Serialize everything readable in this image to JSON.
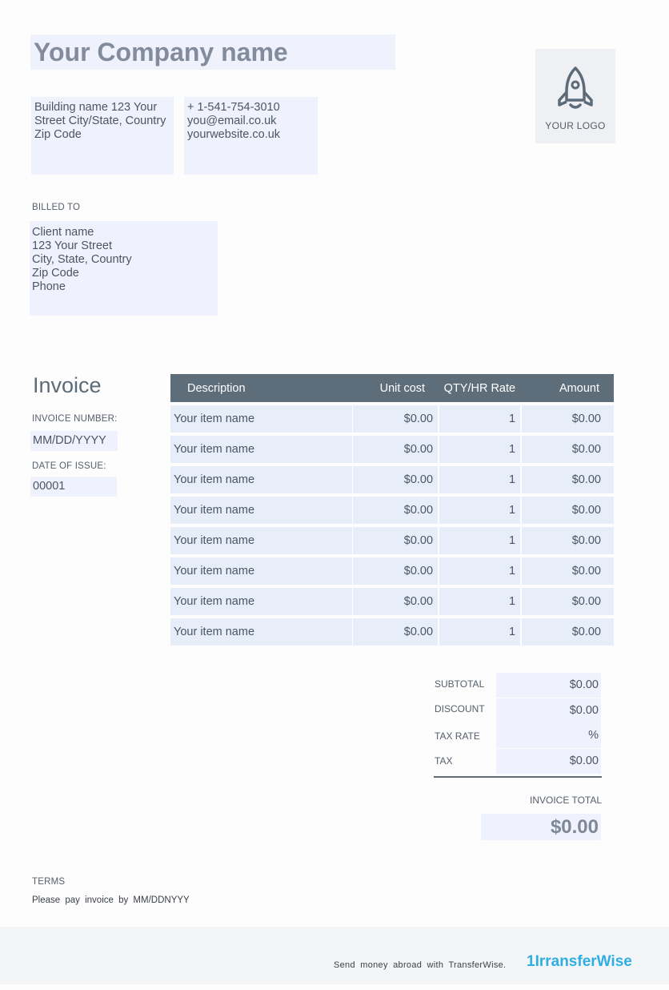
{
  "company": {
    "name": "Your Company name",
    "address": [
      "Building name 123 Your",
      "Street City/State, Country",
      "Zip Code"
    ],
    "contact": [
      "+ 1-541-754-3010",
      "you@email.co.uk",
      "yourwebsite.co.uk"
    ],
    "logo_label": "YOUR LOGO"
  },
  "billed_to": {
    "label": "BILLED TO",
    "lines": [
      "Client name",
      "123 Your Street",
      "City, State, Country",
      "Zip Code",
      "Phone"
    ]
  },
  "invoice": {
    "title": "Invoice",
    "number_label": "INVOICE NUMBER:",
    "number_value": "MM/DD/YYYY",
    "date_label": "DATE OF ISSUE:",
    "date_value": "00001"
  },
  "table": {
    "headers": [
      "Description",
      "Unit cost",
      "QTY/HR Rate",
      "Amount"
    ],
    "rows": [
      {
        "description": "Your item name",
        "unit_cost": "$0.00",
        "qty": "1",
        "amount": "$0.00"
      },
      {
        "description": "Your item name",
        "unit_cost": "$0.00",
        "qty": "1",
        "amount": "$0.00"
      },
      {
        "description": "Your item name",
        "unit_cost": "$0.00",
        "qty": "1",
        "amount": "$0.00"
      },
      {
        "description": "Your item name",
        "unit_cost": "$0.00",
        "qty": "1",
        "amount": "$0.00"
      },
      {
        "description": "Your item name",
        "unit_cost": "$0.00",
        "qty": "1",
        "amount": "$0.00"
      },
      {
        "description": "Your item name",
        "unit_cost": "$0.00",
        "qty": "1",
        "amount": "$0.00"
      },
      {
        "description": "Your item name",
        "unit_cost": "$0.00",
        "qty": "1",
        "amount": "$0.00"
      },
      {
        "description": "Your item name",
        "unit_cost": "$0.00",
        "qty": "1",
        "amount": "$0.00"
      }
    ]
  },
  "totals": {
    "subtotal_label": "SUBTOTAL",
    "subtotal_value": "$0.00",
    "discount_label": "DISCOUNT",
    "discount_value": "$0.00",
    "tax_rate_label": "TAX RATE",
    "tax_rate_value": "%",
    "tax_label": "TAX",
    "tax_value": "$0.00",
    "invoice_total_label": "INVOICE TOTAL",
    "invoice_total_value": "$0.00"
  },
  "terms": {
    "label": "TERMS",
    "text": "Please pay invoice by MM/DDNYYY"
  },
  "footer": {
    "text": "Send money abroad with TransferWise.",
    "brand": "1IrransferWise"
  },
  "colors": {
    "field_background": "#eff2fd",
    "table_header": "#5d6e7a",
    "brand": "#2eaee4"
  },
  "icons": {
    "logo": "rocket-icon"
  }
}
